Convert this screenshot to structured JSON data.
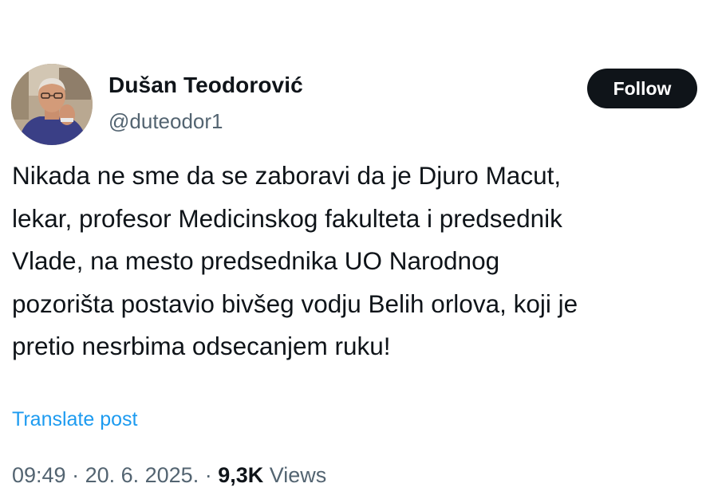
{
  "author": {
    "name": "Dušan Teodorović",
    "handle": "@duteodor1"
  },
  "follow_button": {
    "label": "Follow"
  },
  "tweet": {
    "lines": [
      "Nikada ne sme da se zaboravi da je Djuro Macut,",
      "lekar, profesor Medicinskog fakulteta i predsednik",
      "Vlade, na mesto predsednika UO Narodnog",
      "pozorišta postavio bivšeg vodju Belih orlova, koji je",
      "pretio nesrbima odsecanjem ruku!"
    ]
  },
  "translate": {
    "label": "Translate post"
  },
  "meta": {
    "time": "09:49",
    "separator1": " · ",
    "date": "20. 6. 2025.",
    "separator2": " · ",
    "views_count": "9,3K",
    "views_label": " Views"
  },
  "colors": {
    "text_primary": "#0f1419",
    "text_secondary": "#536471",
    "link": "#1d9bf0",
    "button_bg": "#0f1419",
    "button_text": "#ffffff"
  }
}
